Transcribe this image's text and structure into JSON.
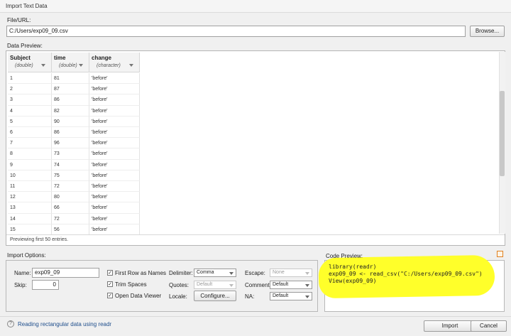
{
  "window": {
    "title": "Import Text Data"
  },
  "file": {
    "label": "File/URL:",
    "value": "C:/Users/exp09_09.csv",
    "browse_label": "Browse..."
  },
  "preview": {
    "label": "Data Preview:",
    "columns": [
      {
        "name": "Subject",
        "type": "(double)"
      },
      {
        "name": "time",
        "type": "(double)"
      },
      {
        "name": "change",
        "type": "(character)"
      }
    ],
    "rows": [
      [
        "1",
        "81",
        "'before'"
      ],
      [
        "2",
        "87",
        "'before'"
      ],
      [
        "3",
        "86",
        "'before'"
      ],
      [
        "4",
        "82",
        "'before'"
      ],
      [
        "5",
        "90",
        "'before'"
      ],
      [
        "6",
        "86",
        "'before'"
      ],
      [
        "7",
        "96",
        "'before'"
      ],
      [
        "8",
        "73",
        "'before'"
      ],
      [
        "9",
        "74",
        "'before'"
      ],
      [
        "10",
        "75",
        "'before'"
      ],
      [
        "11",
        "72",
        "'before'"
      ],
      [
        "12",
        "80",
        "'before'"
      ],
      [
        "13",
        "66",
        "'before'"
      ],
      [
        "14",
        "72",
        "'before'"
      ],
      [
        "15",
        "56",
        "'before'"
      ]
    ],
    "status": "Previewing first 50 entries."
  },
  "options": {
    "label": "Import Options:",
    "name_label": "Name:",
    "name_value": "exp09_09",
    "skip_label": "Skip:",
    "skip_value": "0",
    "first_row_label": "First Row as Names",
    "trim_label": "Trim Spaces",
    "open_viewer_label": "Open Data Viewer",
    "check_mark": "✓",
    "delimiter_label": "Delimiter:",
    "delimiter_value": "Comma",
    "quotes_label": "Quotes:",
    "quotes_value": "Default",
    "locale_label": "Locale:",
    "configure_label": "Configure...",
    "escape_label": "Escape:",
    "escape_value": "None",
    "comment_label": "Comment:",
    "comment_value": "Default",
    "na_label": "NA:",
    "na_value": "Default"
  },
  "code": {
    "label": "Code Preview:",
    "lines": [
      "library(readr)",
      "exp09_09 <- read_csv(\"C:/Users/exp09_09.csv\")",
      "View(exp09_09)"
    ],
    "highlight_color": "#ffff2a"
  },
  "footer": {
    "help_glyph": "?",
    "help_link": "Reading rectangular data using readr",
    "import_label": "Import",
    "cancel_label": "Cancel"
  }
}
